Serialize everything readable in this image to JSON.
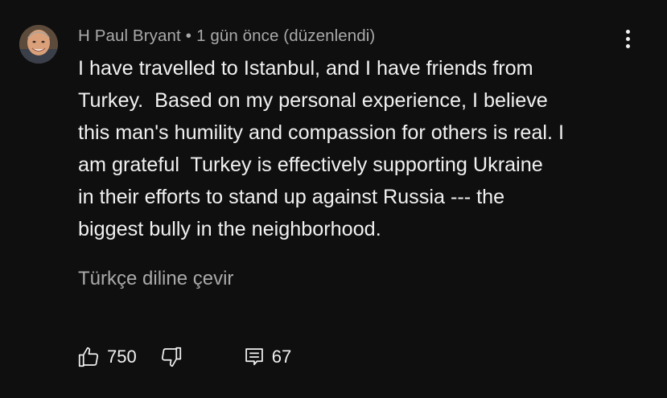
{
  "comment": {
    "author": "H Paul Bryant",
    "separator": "•",
    "time": "1 gün önce (düzenlendi)",
    "text": "I have travelled to Istanbul, and I have friends from\nTurkey.  Based on my personal experience, I believe\nthis man's humility and compassion for others is real. I\nam grateful  Turkey is effectively supporting Ukraine\nin their efforts to stand up against Russia --- the\nbiggest bully in the neighborhood.",
    "translate_label": "Türkçe diline çevir",
    "likes": "750",
    "replies": "67"
  },
  "icons": {
    "menu": "more-vert-icon",
    "like": "thumb-up-icon",
    "dislike": "thumb-down-icon",
    "reply": "comment-icon"
  },
  "colors": {
    "background": "#0f0f0f",
    "text_primary": "#f1f1f1",
    "text_secondary": "#aaaaaa"
  }
}
